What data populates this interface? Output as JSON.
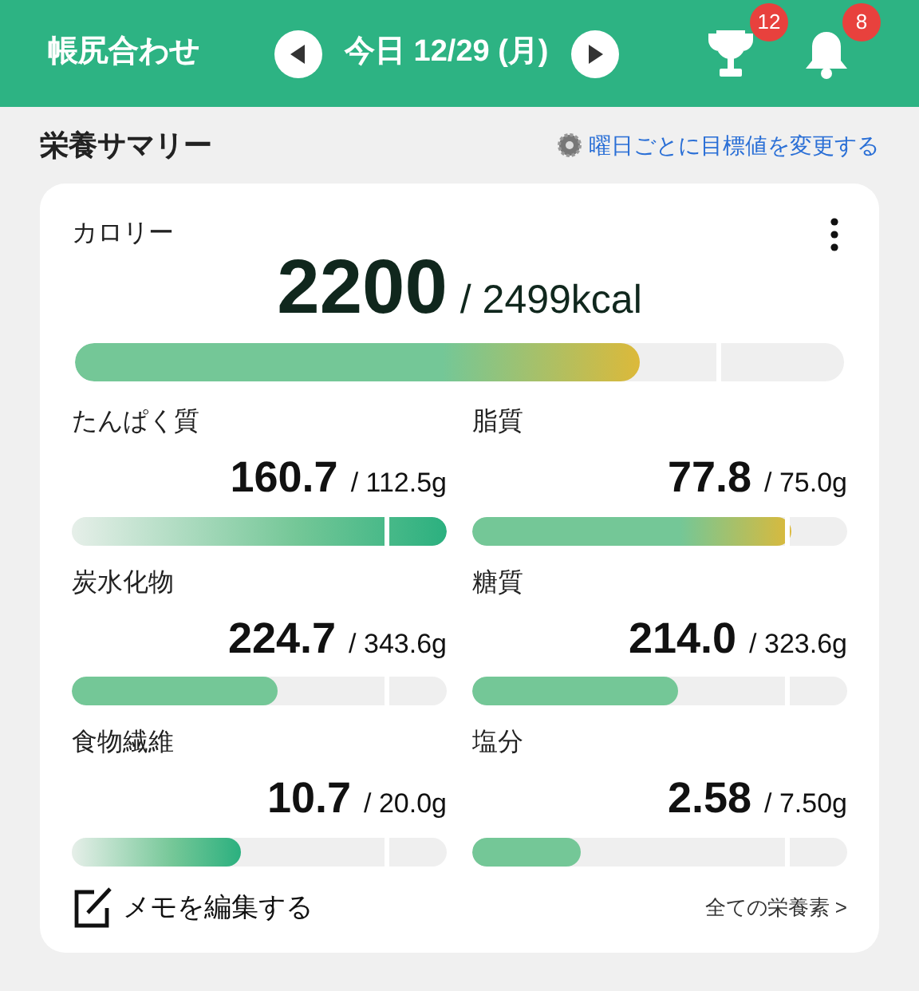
{
  "header": {
    "title": "帳尻合わせ",
    "date": "今日 12/29 (月)",
    "trophy_badge": "12",
    "bell_badge": "8"
  },
  "section": {
    "title": "栄養サマリー",
    "link": "曜日ごとに目標値を変更する"
  },
  "calorie": {
    "label": "カロリー",
    "value": "2200",
    "target": "/ 2499kcal",
    "level": 0.735,
    "kind": "warn"
  },
  "nutrients": [
    {
      "label": "たんぱく質",
      "value": "160.7",
      "target": "/ 112.5g",
      "level": 1,
      "kind": "fade"
    },
    {
      "label": "脂質",
      "value": "77.8",
      "target": "/ 75.0g",
      "level": 0.85,
      "kind": "warn"
    },
    {
      "label": "炭水化物",
      "value": "224.7",
      "target": "/ 343.6g",
      "level": 0.55,
      "kind": "solid"
    },
    {
      "label": "糖質",
      "value": "214.0",
      "target": "/ 323.6g",
      "level": 0.55,
      "kind": "solid"
    },
    {
      "label": "食物繊維",
      "value": "10.7",
      "target": "/ 20.0g",
      "level": 0.45,
      "kind": "fade"
    },
    {
      "label": "塩分",
      "value": "2.58",
      "target": "/ 7.50g",
      "level": 0.29,
      "kind": "solid"
    }
  ],
  "footer": {
    "memo": "メモを編集する",
    "all": "全ての栄養素 >"
  }
}
